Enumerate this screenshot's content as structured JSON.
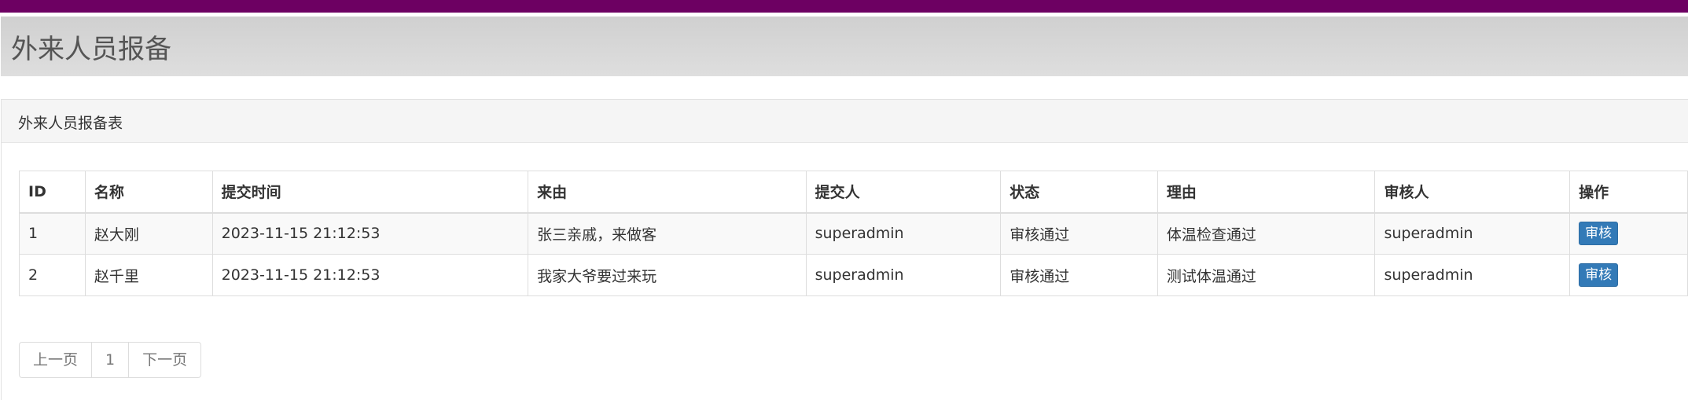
{
  "page_title": "外来人员报备",
  "panel": {
    "title": "外来人员报备表"
  },
  "table": {
    "columns": [
      "ID",
      "名称",
      "提交时间",
      "来由",
      "提交人",
      "状态",
      "理由",
      "审核人",
      "操作"
    ],
    "rows": [
      {
        "id": "1",
        "name": "赵大刚",
        "submit_time": "2023-11-15 21:12:53",
        "reason": "张三亲戚，来做客",
        "submitter": "superadmin",
        "status": "审核通过",
        "review_reason": "体温检查通过",
        "reviewer": "superadmin",
        "action": "审核"
      },
      {
        "id": "2",
        "name": "赵千里",
        "submit_time": "2023-11-15 21:12:53",
        "reason": "我家大爷要过来玩",
        "submitter": "superadmin",
        "status": "审核通过",
        "review_reason": "测试体温通过",
        "reviewer": "superadmin",
        "action": "审核"
      }
    ]
  },
  "pagination": {
    "prev_label": "上一页",
    "current_page": "1",
    "next_label": "下一页"
  },
  "colors": {
    "top_bar": "#6d0062",
    "button": "#337ab7"
  }
}
